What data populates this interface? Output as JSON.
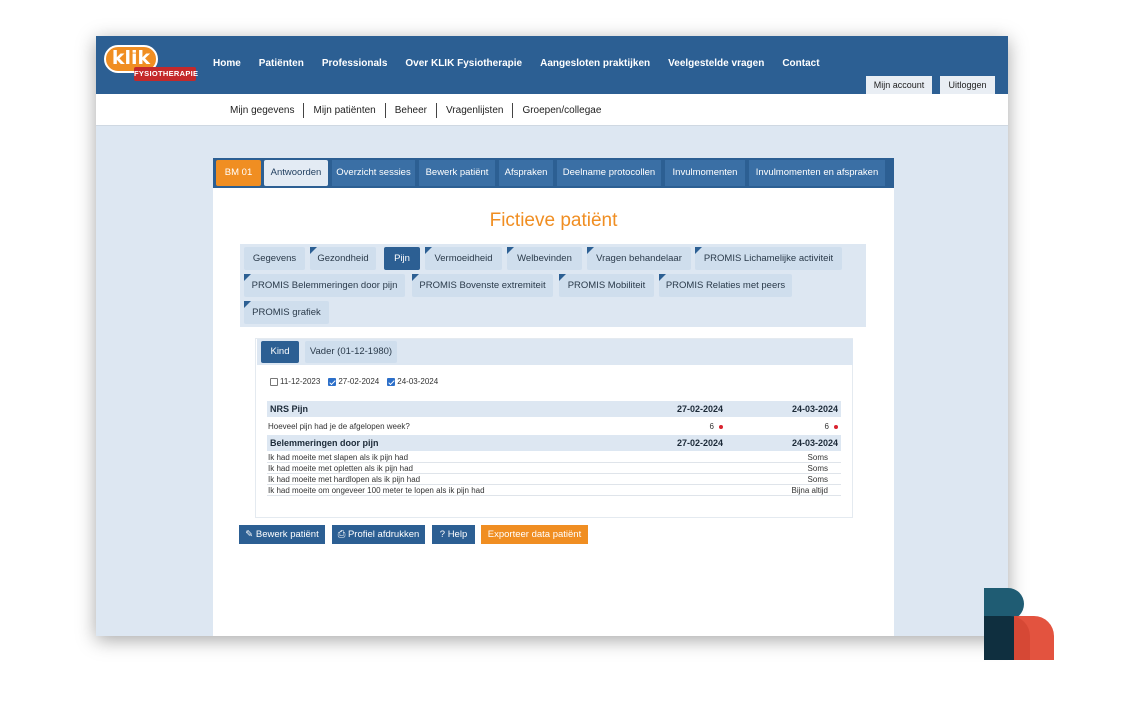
{
  "logo": {
    "word": "klik",
    "tag": "FYSIOTHERAPIE"
  },
  "main_nav": [
    "Home",
    "Patiënten",
    "Professionals",
    "Over KLIK Fysiotherapie",
    "Aangesloten praktijken",
    "Veelgestelde vragen",
    "Contact"
  ],
  "account": {
    "my_account": "Mijn account",
    "logout": "Uitloggen"
  },
  "sub_nav": [
    "Mijn gegevens",
    "Mijn patiënten",
    "Beheer",
    "Vragenlijsten",
    "Groepen/collegae"
  ],
  "patient_tabs": {
    "badge": "BM 01",
    "items": [
      "Antwoorden",
      "Overzicht sessies",
      "Bewerk patiënt",
      "Afspraken",
      "Deelname protocollen",
      "Invulmomenten",
      "Invulmomenten en afspraken"
    ],
    "active": "Antwoorden"
  },
  "page_title": "Fictieve patiënt",
  "questionnaire_tabs": {
    "items": [
      "Gegevens",
      "Gezondheid",
      "Pijn",
      "Vermoeidheid",
      "Welbevinden",
      "Vragen behandelaar",
      "PROMIS Lichamelijke activiteit",
      "PROMIS Belemmeringen door pijn",
      "PROMIS Bovenste extremiteit",
      "PROMIS Mobiliteit",
      "PROMIS Relaties met peers",
      "PROMIS grafiek"
    ],
    "active": "Pijn"
  },
  "respondent_tabs": {
    "items": [
      "Kind",
      "Vader (01-12-1980)"
    ],
    "active": "Kind"
  },
  "date_filters": [
    {
      "label": "11-12-2023",
      "checked": false
    },
    {
      "label": "27-02-2024",
      "checked": true
    },
    {
      "label": "24-03-2024",
      "checked": true
    }
  ],
  "sections": [
    {
      "title": "NRS Pijn",
      "dates": [
        "27-02-2024",
        "24-03-2024"
      ],
      "rows": [
        {
          "question": "Hoeveel pijn had je de afgelopen week?",
          "values": [
            "6",
            "6"
          ]
        }
      ]
    },
    {
      "title": "Belemmeringen door pijn",
      "dates": [
        "27-02-2024",
        "24-03-2024"
      ],
      "rows": [
        {
          "question": "Ik had moeite met slapen als ik pijn had",
          "value": "Soms"
        },
        {
          "question": "Ik had moeite met opletten als ik pijn had",
          "value": "Soms"
        },
        {
          "question": "Ik had moeite met hardlopen als ik pijn had",
          "value": "Soms"
        },
        {
          "question": "Ik had moeite om ongeveer 100 meter te lopen als ik pijn had",
          "value": "Bijna altijd"
        }
      ]
    }
  ],
  "actions": {
    "edit": "Bewerk patiënt",
    "print": "Profiel afdrukken",
    "help": "Help",
    "export": "Exporteer data patiënt"
  },
  "colors": {
    "brand_blue": "#2c5f93",
    "accent_orange": "#f08e22",
    "alert_red": "#d9232f"
  }
}
